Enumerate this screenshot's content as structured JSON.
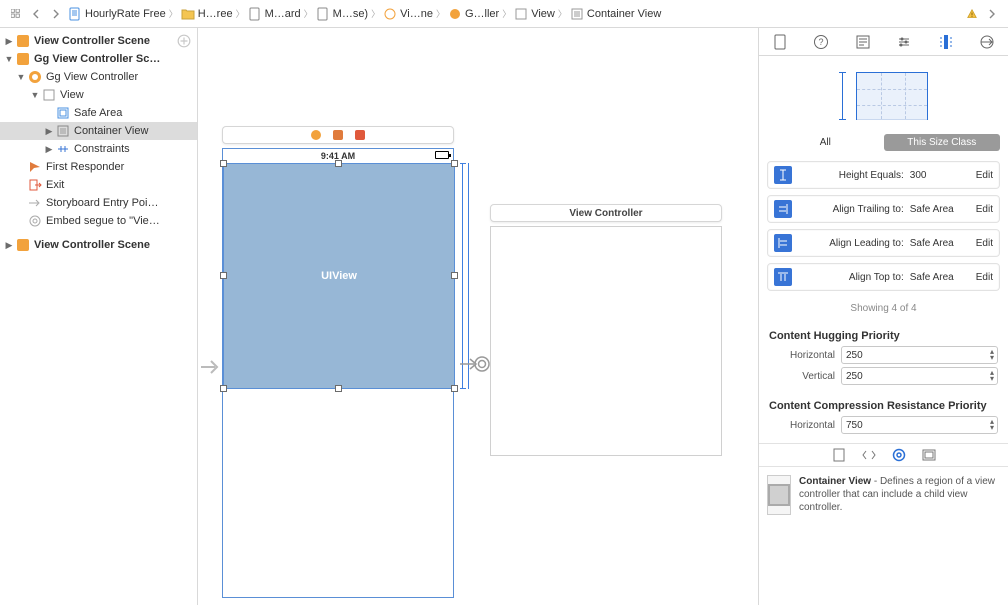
{
  "breadcrumb": {
    "items": [
      {
        "icon": "doc-blue",
        "label": "HourlyRate Free"
      },
      {
        "icon": "folder",
        "label": "H…ree"
      },
      {
        "icon": "doc",
        "label": "M…ard"
      },
      {
        "icon": "doc",
        "label": "M…se)"
      },
      {
        "icon": "scene",
        "label": "Vi…ne"
      },
      {
        "icon": "vc",
        "label": "G…ller"
      },
      {
        "icon": "view",
        "label": "View"
      },
      {
        "icon": "view",
        "label": "Container View"
      }
    ]
  },
  "outline": {
    "scene1": "View Controller Scene",
    "scene2": "Gg View Controller Sc…",
    "vc": "Gg View Controller",
    "view": "View",
    "safearea": "Safe Area",
    "container": "Container View",
    "constraints": "Constraints",
    "first_responder": "First Responder",
    "exit": "Exit",
    "entry": "Storyboard Entry Poi…",
    "embed": "Embed segue to \"Vie…",
    "scene3": "View Controller Scene"
  },
  "canvas": {
    "status_time": "9:41 AM",
    "uiview_label": "UIView",
    "vc2_title": "View Controller"
  },
  "inspector": {
    "size_seg_all": "All",
    "size_seg_this": "This Size Class",
    "constraints": [
      {
        "label": "Height Equals:",
        "value": "300",
        "edit": "Edit"
      },
      {
        "label": "Align Trailing to:",
        "value": "Safe Area",
        "edit": "Edit"
      },
      {
        "label": "Align Leading to:",
        "value": "Safe Area",
        "edit": "Edit"
      },
      {
        "label": "Align Top to:",
        "value": "Safe Area",
        "edit": "Edit"
      }
    ],
    "showing": "Showing 4 of 4",
    "hugging_title": "Content Hugging Priority",
    "hugging_h_label": "Horizontal",
    "hugging_h_value": "250",
    "hugging_v_label": "Vertical",
    "hugging_v_value": "250",
    "compression_title": "Content Compression Resistance Priority",
    "compression_h_label": "Horizontal",
    "compression_h_value": "750",
    "help_title": "Container View",
    "help_desc": " - Defines a region of a view controller that can include a child view controller."
  }
}
